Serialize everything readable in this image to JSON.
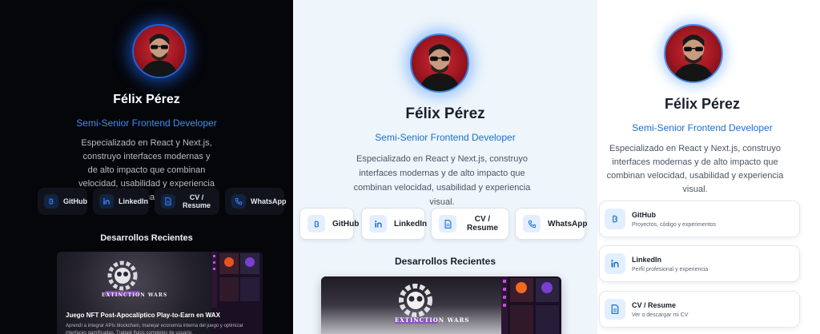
{
  "profile": {
    "name": "Félix Pérez",
    "role": "Semi-Senior Frontend Developer",
    "description": "Especializado en React y Next.js, construyo interfaces modernas y de alto impacto que combinan velocidad, usabilidad y experiencia visual."
  },
  "links": [
    {
      "label": "GitHub",
      "icon": "github-icon",
      "subtitle": "Proyectos, código y experimentos"
    },
    {
      "label": "LinkedIn",
      "icon": "linkedin-icon",
      "subtitle": "Perfil profesional y experiencia"
    },
    {
      "label": "CV / Resume",
      "icon": "document-icon",
      "subtitle": "Ver o descargar mi CV"
    },
    {
      "label": "WhatsApp",
      "icon": "phone-icon"
    }
  ],
  "recent": {
    "heading": "Desarrollos Recientes",
    "project": {
      "title": "Juego NFT Post-Apocalíptico Play-to-Earn en WAX",
      "description": "Aprendí a integrar APIs blockchain, manejar economía interna del juego y optimizar interfaces gamificadas. Trabajé flujos complejos de usuario.",
      "logo_text": "EXTINCTION WARS"
    }
  },
  "colors": {
    "accent_dark": "#3f8bff",
    "accent_light": "#1a6fd0",
    "avatar_bg": "#c0202b"
  }
}
